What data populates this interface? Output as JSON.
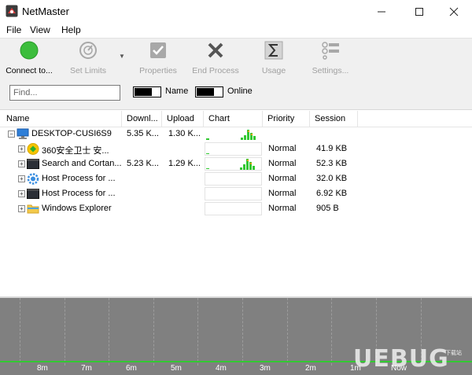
{
  "window": {
    "title": "NetMaster",
    "icon": "netmaster-app-icon",
    "controls": {
      "minimize": "—",
      "maximize": "☐",
      "close": "✕"
    }
  },
  "menu": [
    "File",
    "View",
    "Help"
  ],
  "toolbar": {
    "connect": {
      "label": "Connect to...",
      "icon": "green-circle-icon",
      "color": "#32b432"
    },
    "set_limits": {
      "label": "Set Limits",
      "icon": "gauge-icon"
    },
    "properties": {
      "label": "Properties",
      "icon": "checkbox-icon"
    },
    "end_process": {
      "label": "End Process",
      "icon": "x-cross-icon"
    },
    "usage": {
      "label": "Usage",
      "icon": "sigma-icon"
    },
    "settings": {
      "label": "Settings...",
      "icon": "settings-sliders-icon"
    }
  },
  "filter": {
    "find_placeholder": "Find...",
    "name_toggle_label": "Name",
    "online_toggle_label": "Online"
  },
  "columns": [
    "Name",
    "Downl...",
    "Upload",
    "Chart",
    "Priority",
    "Session"
  ],
  "rows": [
    {
      "expander": "⊟",
      "name": "DESKTOP-CUSI6S9",
      "download": "5.35 K...",
      "upload": "1.30 K...",
      "priority": "",
      "session": "",
      "icon": "computer-icon"
    },
    {
      "expander": "⊞",
      "name": "360安全卫士 安...",
      "download": "",
      "upload": "",
      "priority": "Normal",
      "session": "41.9 KB",
      "icon": "360-security-icon"
    },
    {
      "expander": "⊞",
      "name": "Search and Cortan...",
      "download": "5.23 K...",
      "upload": "1.29 K...",
      "priority": "Normal",
      "session": "52.3 KB",
      "icon": "window-app-icon"
    },
    {
      "expander": "⊞",
      "name": "Host Process for ...",
      "download": "",
      "upload": "",
      "priority": "Normal",
      "session": "32.0 KB",
      "icon": "gear-icon"
    },
    {
      "expander": "⊞",
      "name": "Host Process for ...",
      "download": "",
      "upload": "",
      "priority": "Normal",
      "session": "6.92 KB",
      "icon": "window-app-icon"
    },
    {
      "expander": "⊞",
      "name": "Windows Explorer",
      "download": "",
      "upload": "",
      "priority": "Normal",
      "session": "905 B",
      "icon": "folder-icon"
    }
  ],
  "timeline": {
    "labels": [
      "8m",
      "7m",
      "6m",
      "5m",
      "4m",
      "3m",
      "2m",
      "1m",
      "Now"
    ],
    "line_color": "#32c832",
    "background": "#808080"
  },
  "watermark": {
    "text": "UEBUG",
    "sub": "下载站"
  }
}
